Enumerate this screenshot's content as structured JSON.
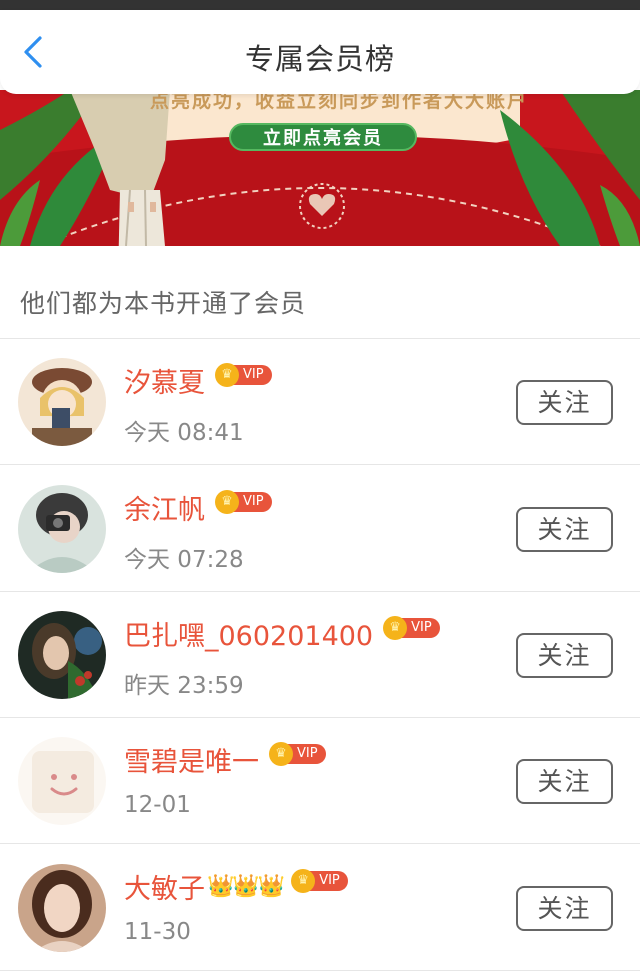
{
  "header": {
    "title": "专属会员榜",
    "back_icon": "chevron-left-icon"
  },
  "banner": {
    "text": "点亮成功，收益立刻同步到作者大大账户",
    "cta_label": "立即点亮会员",
    "colors": {
      "red": "#c8161d",
      "green": "#2e8b3e"
    }
  },
  "section": {
    "title": "他们都为本书开通了会员"
  },
  "members": [
    {
      "name": "汐慕夏",
      "crowns": "",
      "badge": "VIP",
      "time": "今天 08:41",
      "follow_label": "关注"
    },
    {
      "name": "余江帆",
      "crowns": "",
      "badge": "VIP",
      "time": "今天 07:28",
      "follow_label": "关注"
    },
    {
      "name": "巴扎嘿_060201400",
      "crowns": "",
      "badge": "VIP",
      "time": "昨天 23:59",
      "follow_label": "关注"
    },
    {
      "name": "雪碧是唯一",
      "crowns": "",
      "badge": "VIP",
      "time": "12-01",
      "follow_label": "关注"
    },
    {
      "name": "大敏子",
      "crowns": "👑👑👑",
      "badge": "VIP",
      "time": "11-30",
      "follow_label": "关注"
    }
  ],
  "colors": {
    "accent": "#e8543b",
    "vip_gold": "#f5b31a",
    "text_gray": "#888888"
  }
}
